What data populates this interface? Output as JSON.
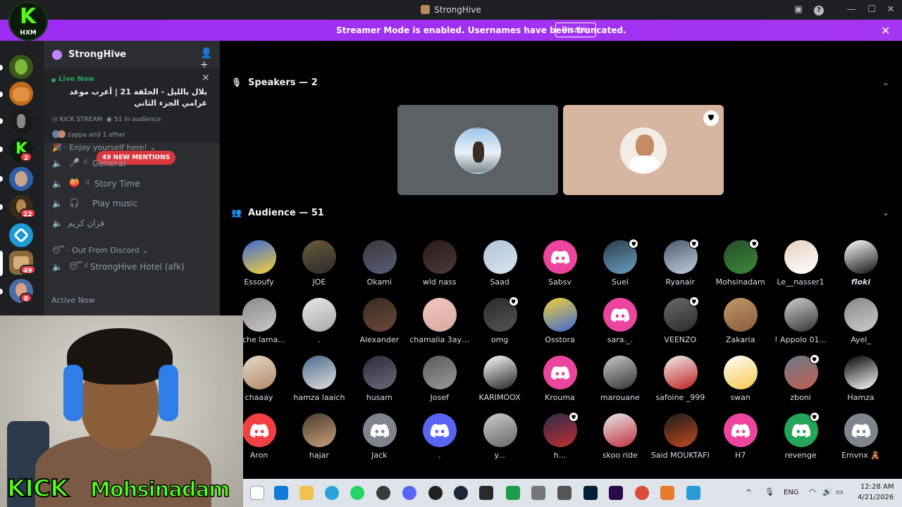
{
  "window": {
    "title": "StrongHive",
    "icons": [
      "notification-inbox-icon",
      "help-icon",
      "minimize-icon",
      "maximize-icon",
      "close-icon"
    ]
  },
  "banner": {
    "message": "Streamer Mode is enabled. Usernames have been truncated.",
    "disable_label": "Disable",
    "color": "#a020f0"
  },
  "rail": {
    "badges": [
      "2",
      "22",
      "49",
      "8"
    ]
  },
  "server": {
    "name": "StrongHive",
    "live": {
      "status": "Live Now",
      "title": "بلال بالليل - الحلقة 21 | أغرب موعد غرامي الجزء الثاني",
      "channel": "KICK STREAM",
      "audience": "51 in audience",
      "viewers": "zappa and 1 other"
    },
    "categories": {
      "enjoy": "Enjoy yourself here!",
      "out_from_discord": "Out From Discord"
    },
    "mentions_badge": "49 NEW MENTIONS",
    "channels": [
      {
        "emoji": "🎤",
        "label": "General"
      },
      {
        "emoji": "🍑",
        "label": "Story Time"
      },
      {
        "emoji": "🎧",
        "label": "Play music"
      },
      {
        "emoji": "",
        "label": "قران كريم"
      }
    ],
    "afk_channel": {
      "emoji": "😴",
      "label": "StrongHive Hotel (afk)"
    },
    "active_now": "Active Now"
  },
  "stage": {
    "speakers_header": "Speakers — 2",
    "audience_header": "Audience — 51",
    "audience": [
      "Essoufy",
      "JOE",
      "Okami",
      "wld nass",
      "Saad",
      "Sabsv",
      "Suel",
      "Ryanair",
      "Mohsinadam",
      "Le__nasser1",
      "floki",
      "ouche lama...",
      ".",
      "Alexander",
      "chamalia 3ayl...",
      "omg",
      "Osstora",
      "sara._.",
      "VEENZO",
      "Zakaria",
      "! Appolo 01...",
      "Ayel_",
      "chaaay",
      "hamza laaich",
      "husam",
      "Josef",
      "KARIMOOX",
      "Krouma",
      "marouane",
      "safoine _999",
      "swan",
      "zboni",
      "Hamza",
      "Aron",
      "hajar",
      "Jack",
      ".",
      "y...",
      "h...",
      "skoo ride",
      "Said MOUKTAFI",
      "H7",
      "revenge",
      "Emvnx 🧸"
    ]
  },
  "overlay": {
    "logo_letter": "K",
    "logo_text": "HXM",
    "kick_text": "KICK",
    "username": "Mohsinadam"
  },
  "taskbar": {
    "lang": "ENG",
    "time": "12:28 AM",
    "date": "4/21/2026"
  }
}
